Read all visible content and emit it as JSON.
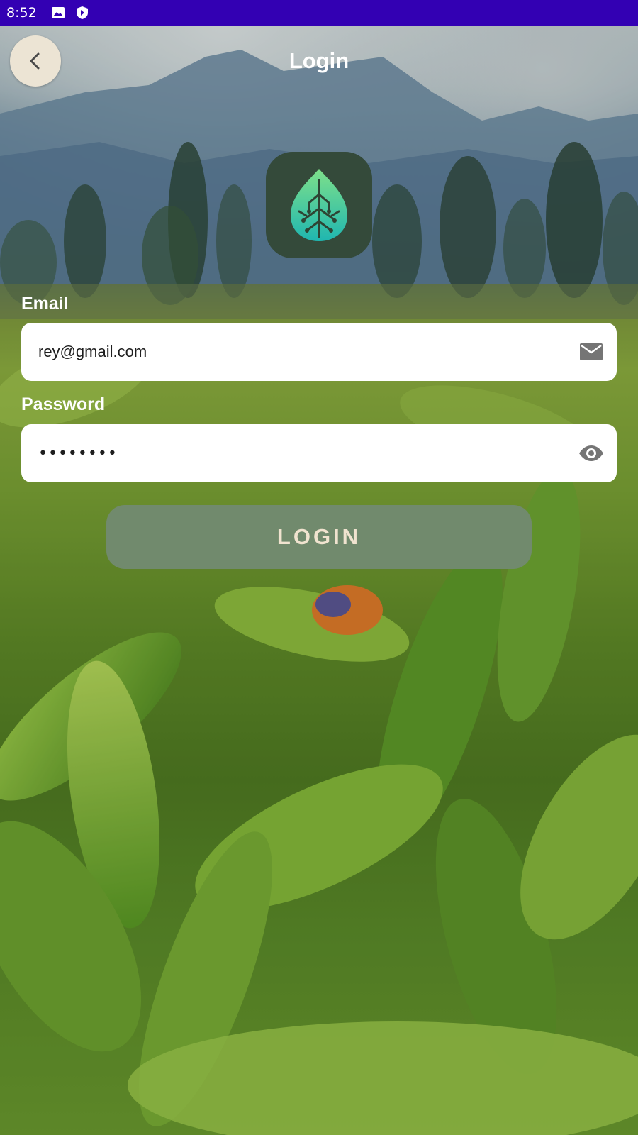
{
  "status_bar": {
    "time": "8:52",
    "icons": [
      "image-icon",
      "shield-icon"
    ]
  },
  "app_bar": {
    "title": "Login",
    "back_icon": "chevron-left-icon"
  },
  "logo": {
    "icon": "leaf-circuit-logo",
    "background": "#344a3a"
  },
  "form": {
    "email": {
      "label": "Email",
      "value": "rey@gmail.com",
      "icon": "mail-icon"
    },
    "password": {
      "label": "Password",
      "value": "••••••••",
      "icon": "eye-icon"
    },
    "submit_label": "LOGIN"
  },
  "colors": {
    "status_bar": "#3300b3",
    "back_button": "#ece4d4",
    "login_button": "#718a6d",
    "login_text": "#f0e3cf"
  }
}
